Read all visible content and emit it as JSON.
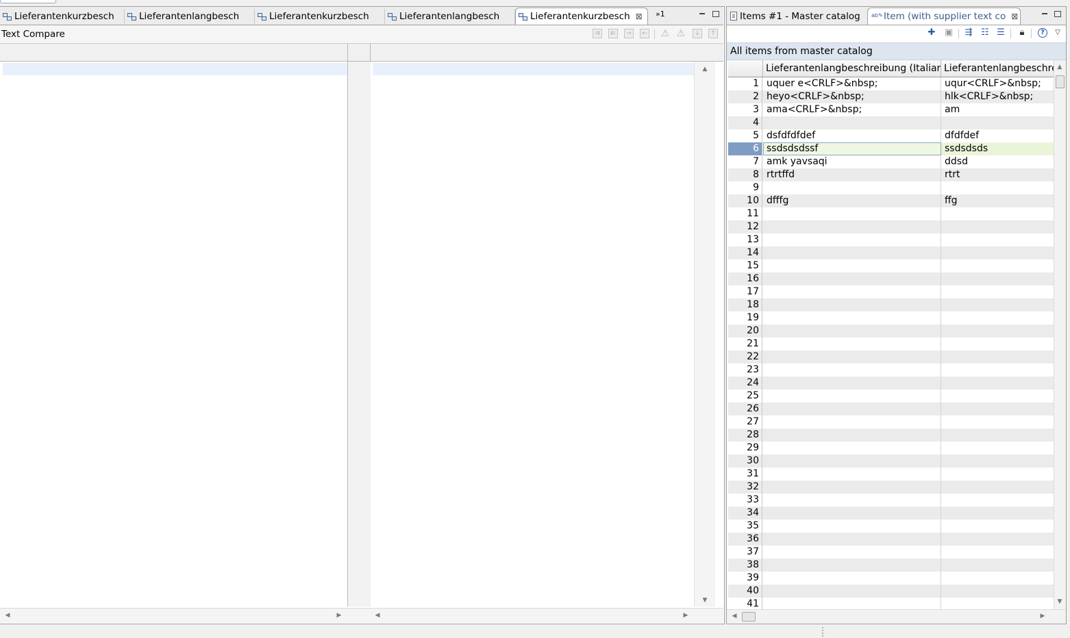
{
  "editor_tabs": [
    {
      "label": "Lieferantenkurzbesch",
      "active": false
    },
    {
      "label": "Lieferantenlangbesch",
      "active": false
    },
    {
      "label": "Lieferantenkurzbesch",
      "active": false
    },
    {
      "label": "Lieferantenlangbesch",
      "active": false
    },
    {
      "label": "Lieferantenkurzbesch",
      "active": true
    }
  ],
  "editor": {
    "more_tabs_count": "»1",
    "compare_title": "Text Compare",
    "toolbar_icons": [
      "copy-all-right-icon",
      "copy-all-left-icon",
      "copy-right-icon",
      "copy-left-icon",
      "next-difference-icon",
      "previous-difference-icon",
      "next-change-icon",
      "previous-change-icon"
    ]
  },
  "right_view": {
    "tabs": [
      {
        "label": "Items #1 - Master catalog",
        "active": false
      },
      {
        "label": "Item (with supplier text co",
        "active": true
      }
    ],
    "header_title": "All items from master catalog",
    "toolbar_icons": [
      "add-icon",
      "save-icon",
      "filter-icon",
      "export-icon",
      "collapse-icon",
      "lock-icon",
      "help-icon",
      "view-menu-icon"
    ],
    "columns": [
      "Lieferantenlangbeschreibung (Italian)",
      "Lieferantenlangbeschre"
    ],
    "selected_row": 6,
    "rows": [
      {
        "num": "1",
        "c1": "uquer e<CRLF>&nbsp;",
        "c2": "uqur<CRLF>&nbsp;"
      },
      {
        "num": "2",
        "c1": "heyo<CRLF>&nbsp;",
        "c2": "hlk<CRLF>&nbsp;"
      },
      {
        "num": "3",
        "c1": "ama<CRLF>&nbsp;",
        "c2": "am"
      },
      {
        "num": "4",
        "c1": "",
        "c2": ""
      },
      {
        "num": "5",
        "c1": "dsfdfdfdef",
        "c2": "dfdfdef"
      },
      {
        "num": "6",
        "c1": "ssdsdsdssf",
        "c2": "ssdsdsds"
      },
      {
        "num": "7",
        "c1": "amk yavsaqi",
        "c2": "ddsd"
      },
      {
        "num": "8",
        "c1": "rtrtffd",
        "c2": "rtrt"
      },
      {
        "num": "9",
        "c1": "",
        "c2": ""
      },
      {
        "num": "10",
        "c1": "dfffg",
        "c2": "ffg"
      },
      {
        "num": "11",
        "c1": "",
        "c2": ""
      },
      {
        "num": "12",
        "c1": "",
        "c2": ""
      },
      {
        "num": "13",
        "c1": "",
        "c2": ""
      },
      {
        "num": "14",
        "c1": "",
        "c2": ""
      },
      {
        "num": "15",
        "c1": "",
        "c2": ""
      },
      {
        "num": "16",
        "c1": "",
        "c2": ""
      },
      {
        "num": "17",
        "c1": "",
        "c2": ""
      },
      {
        "num": "18",
        "c1": "",
        "c2": ""
      },
      {
        "num": "19",
        "c1": "",
        "c2": ""
      },
      {
        "num": "20",
        "c1": "",
        "c2": ""
      },
      {
        "num": "21",
        "c1": "",
        "c2": ""
      },
      {
        "num": "22",
        "c1": "",
        "c2": ""
      },
      {
        "num": "23",
        "c1": "",
        "c2": ""
      },
      {
        "num": "24",
        "c1": "",
        "c2": ""
      },
      {
        "num": "25",
        "c1": "",
        "c2": ""
      },
      {
        "num": "26",
        "c1": "",
        "c2": ""
      },
      {
        "num": "27",
        "c1": "",
        "c2": ""
      },
      {
        "num": "28",
        "c1": "",
        "c2": ""
      },
      {
        "num": "29",
        "c1": "",
        "c2": ""
      },
      {
        "num": "30",
        "c1": "",
        "c2": ""
      },
      {
        "num": "31",
        "c1": "",
        "c2": ""
      },
      {
        "num": "32",
        "c1": "",
        "c2": ""
      },
      {
        "num": "33",
        "c1": "",
        "c2": ""
      },
      {
        "num": "34",
        "c1": "",
        "c2": ""
      },
      {
        "num": "35",
        "c1": "",
        "c2": ""
      },
      {
        "num": "36",
        "c1": "",
        "c2": ""
      },
      {
        "num": "37",
        "c1": "",
        "c2": ""
      },
      {
        "num": "38",
        "c1": "",
        "c2": ""
      },
      {
        "num": "39",
        "c1": "",
        "c2": ""
      },
      {
        "num": "40",
        "c1": "",
        "c2": ""
      },
      {
        "num": "41",
        "c1": "",
        "c2": ""
      }
    ]
  },
  "colors": {
    "selection_row_number_bg": "#7f9dc4",
    "selected_row_bg": "#eaf5d8",
    "header_bg": "#dde5ee",
    "alt_row_bg": "#ebebeb"
  }
}
